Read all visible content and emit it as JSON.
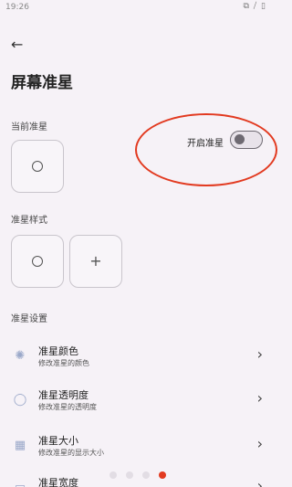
{
  "status_bar": {
    "time": "19:26",
    "icons": "⧉ ⧸ ▯"
  },
  "page": {
    "title": "屏幕准星",
    "back_icon": "arrow-left-icon"
  },
  "current_crosshair": {
    "label": "当前准星"
  },
  "toggle": {
    "label": "开启准星",
    "state": "off"
  },
  "styles": {
    "label": "准星样式"
  },
  "settings": {
    "label": "准星设置",
    "items": [
      {
        "name": "准星颜色",
        "desc": "修改准星的颜色",
        "icon": "palette-icon"
      },
      {
        "name": "准星透明度",
        "desc": "修改准星的透明度",
        "icon": "droplet-icon"
      },
      {
        "name": "准星大小",
        "desc": "修改准星的显示大小",
        "icon": "resize-icon"
      },
      {
        "name": "准星宽度",
        "desc": "",
        "icon": "width-icon"
      }
    ]
  },
  "pager": {
    "count": 4,
    "active_index": 3
  },
  "colors": {
    "accent": "#e23a20",
    "background": "#f6f2f7"
  }
}
